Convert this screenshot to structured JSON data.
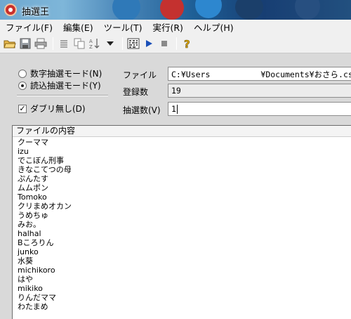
{
  "window": {
    "title": "抽選王"
  },
  "menu": [
    {
      "label": "ファイル(F)"
    },
    {
      "label": "編集(E)"
    },
    {
      "label": "ツール(T)"
    },
    {
      "label": "実行(R)"
    },
    {
      "label": "ヘルプ(H)"
    }
  ],
  "toolbar": {
    "icons": [
      "open-folder-icon",
      "save-icon",
      "print-icon",
      "list-icon",
      "copy-icon",
      "sort-icon",
      "dropdown-icon",
      "shuffle-icon",
      "play-icon",
      "stop-icon",
      "help-icon"
    ]
  },
  "mode": {
    "numeric_label": "数字抽選モード(N)",
    "load_label": "読込抽選モード(Y)",
    "selected": "load",
    "no_duplicates_label": "ダブリ無し(D)",
    "no_duplicates_checked": true
  },
  "info": {
    "file_label": "ファイル",
    "file_path_prefix": "C:¥Users",
    "file_path_suffix": "¥Documents¥おさら.cs",
    "registered_label": "登録数",
    "registered_value": "19",
    "draw_count_label": "抽選数(V)",
    "draw_count_value": "1"
  },
  "list": {
    "header": "ファイルの内容",
    "items": [
      "クーママ",
      "izu",
      "でこぼん刑事",
      "きなこてつの母",
      "ぷんたす",
      "ムムポン",
      "Tomoko",
      "クリまめオカン",
      "うめちゅ",
      "みお。",
      "halhal",
      "Bころりん",
      "junko",
      "水葵",
      "michikoro",
      "はや",
      "mikiko",
      "りんだママ",
      "わたまめ"
    ]
  },
  "colors": {
    "accent": "#1e5f96",
    "list_bg": "#ffffff",
    "panel_bg": "#d9d9d9"
  }
}
